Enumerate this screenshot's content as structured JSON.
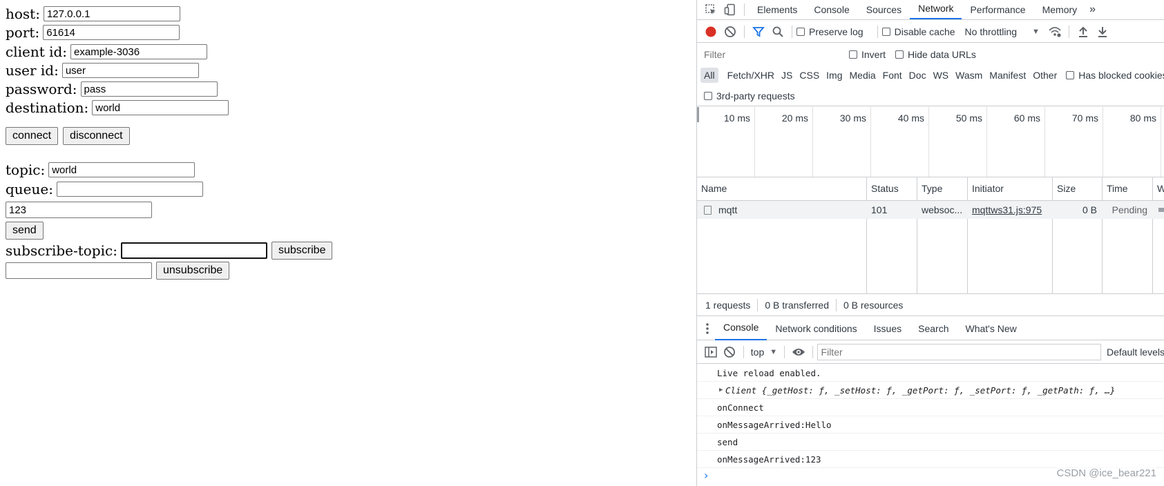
{
  "form": {
    "host_label": "host:",
    "host_value": "127.0.0.1",
    "port_label": "port:",
    "port_value": "61614",
    "client_id_label": "client id:",
    "client_id_value": "example-3036",
    "user_id_label": "user id:",
    "user_id_value": "user",
    "password_label": "password:",
    "password_value": "pass",
    "destination_label": "destination:",
    "destination_value": "world",
    "connect_label": "connect",
    "disconnect_label": "disconnect",
    "topic_label": "topic:",
    "topic_value": "world",
    "queue_label": "queue:",
    "queue_value": "",
    "message_value": "123",
    "send_label": "send",
    "subscribe_topic_label": "subscribe-topic:",
    "subscribe_topic_value": "",
    "subscribe_label": "subscribe",
    "unsubscribe_value": "",
    "unsubscribe_label": "unsubscribe"
  },
  "devtools": {
    "tabs": [
      "Elements",
      "Console",
      "Sources",
      "Network",
      "Performance",
      "Memory"
    ],
    "active_tab": "Network",
    "more_tabs": "»",
    "toolbar": {
      "preserve_log": "Preserve log",
      "disable_cache": "Disable cache",
      "throttling": "No throttling"
    },
    "filter": {
      "placeholder": "Filter",
      "invert": "Invert",
      "hide_data_urls": "Hide data URLs"
    },
    "types": [
      "All",
      "Fetch/XHR",
      "JS",
      "CSS",
      "Img",
      "Media",
      "Font",
      "Doc",
      "WS",
      "Wasm",
      "Manifest",
      "Other"
    ],
    "has_blocked": "Has blocked cookies",
    "third_party": "3rd-party requests",
    "timeline_ticks": [
      "10 ms",
      "20 ms",
      "30 ms",
      "40 ms",
      "50 ms",
      "60 ms",
      "70 ms",
      "80 ms"
    ],
    "table": {
      "headers": [
        "Name",
        "Status",
        "Type",
        "Initiator",
        "Size",
        "Time",
        "Waterfall"
      ],
      "rows": [
        {
          "name": "mqtt",
          "status": "101",
          "type": "websoc...",
          "initiator": "mqttws31.js:975",
          "size": "0 B",
          "time": "Pending"
        }
      ]
    },
    "summary": {
      "requests": "1 requests",
      "transferred": "0 B transferred",
      "resources": "0 B resources"
    },
    "drawer_tabs": [
      "Console",
      "Network conditions",
      "Issues",
      "Search",
      "What's New"
    ],
    "console_toolbar": {
      "context": "top",
      "filter_placeholder": "Filter",
      "levels": "Default levels"
    },
    "console_messages": [
      "Live reload enabled.",
      "Client {_getHost: ƒ, _setHost: ƒ, _getPort: ƒ, _setPort: ƒ, _getPath: ƒ, …}",
      "onConnect",
      "onMessageArrived:Hello",
      "send",
      "onMessageArrived:123"
    ],
    "prompt": "›"
  },
  "watermark": "CSDN @ice_bear221",
  "colors": {
    "accent": "#1a73e8",
    "record": "#d93025",
    "link": "#303942"
  }
}
